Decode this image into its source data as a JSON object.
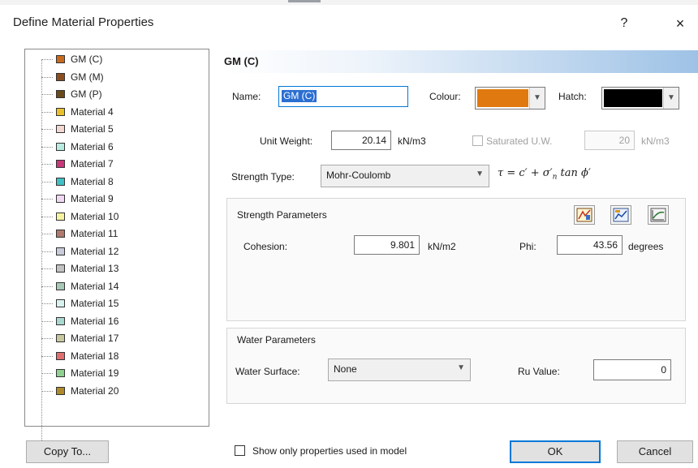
{
  "window": {
    "title": "Define Material Properties",
    "help_glyph": "?",
    "close_glyph": "×"
  },
  "materials": [
    {
      "label": "GM (C)",
      "color": "#c86a1e"
    },
    {
      "label": "GM (M)",
      "color": "#8b4f1e"
    },
    {
      "label": "GM (P)",
      "color": "#6b4a1a"
    },
    {
      "label": "Material 4",
      "color": "#e8c02a"
    },
    {
      "label": "Material 5",
      "color": "#f2d8d0"
    },
    {
      "label": "Material 6",
      "color": "#b8ece0"
    },
    {
      "label": "Material 7",
      "color": "#c8387a"
    },
    {
      "label": "Material 8",
      "color": "#3fc0c4"
    },
    {
      "label": "Material 9",
      "color": "#f0d8f2"
    },
    {
      "label": "Material 10",
      "color": "#f6f3a0"
    },
    {
      "label": "Material 11",
      "color": "#b07a6e"
    },
    {
      "label": "Material 12",
      "color": "#c8ccd8"
    },
    {
      "label": "Material 13",
      "color": "#c2c2c2"
    },
    {
      "label": "Material 14",
      "color": "#a8c8b8"
    },
    {
      "label": "Material 15",
      "color": "#d8f2f0"
    },
    {
      "label": "Material 16",
      "color": "#a8d8d0"
    },
    {
      "label": "Material 17",
      "color": "#c8c8a0"
    },
    {
      "label": "Material 18",
      "color": "#e07070"
    },
    {
      "label": "Material 19",
      "color": "#90d090"
    },
    {
      "label": "Material 20",
      "color": "#b08a2a"
    }
  ],
  "selected": {
    "header": "GM (C)",
    "name_label": "Name:",
    "name_value": "GM (C)",
    "colour_label": "Colour:",
    "colour_value": "#e07a10",
    "hatch_label": "Hatch:",
    "hatch_value": "#000000",
    "unit_weight_label": "Unit Weight:",
    "unit_weight_value": "20.14",
    "unit_weight_unit": "kN/m3",
    "saturated_label": "Saturated U.W.",
    "saturated_value": "20",
    "saturated_unit": "kN/m3",
    "strength_type_label": "Strength Type:",
    "strength_type_value": "Mohr-Coulomb"
  },
  "strength": {
    "group_title": "Strength Parameters",
    "cohesion_label": "Cohesion:",
    "cohesion_value": "9.801",
    "cohesion_unit": "kN/m2",
    "phi_label": "Phi:",
    "phi_value": "43.56",
    "phi_unit": "degrees"
  },
  "water": {
    "group_title": "Water Parameters",
    "surface_label": "Water Surface:",
    "surface_value": "None",
    "ru_label": "Ru Value:",
    "ru_value": "0"
  },
  "footer": {
    "copy_label": "Copy To...",
    "show_only_label": "Show only properties used in model",
    "ok_label": "OK",
    "cancel_label": "Cancel"
  }
}
